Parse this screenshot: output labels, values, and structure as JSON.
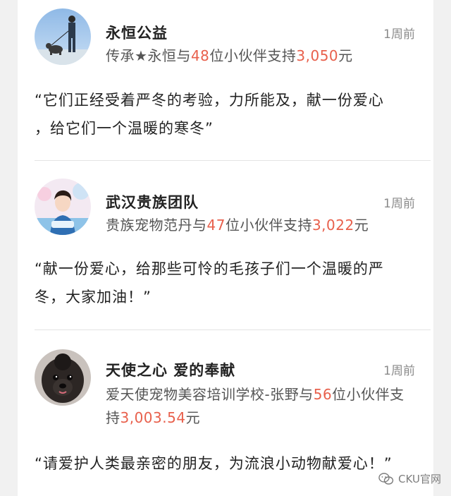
{
  "posts": [
    {
      "name": "永恒公益",
      "time": "1周前",
      "supporter": "传承★永恒",
      "mid1": "与",
      "count": "48",
      "mid2": "位小伙伴支持",
      "amount": "3,050",
      "unit": "元",
      "quote_line1": "“它们正经受着严冬的考验，力所能及，献一份爱心",
      "quote_line2": "，给它们一个温暖的寒冬”"
    },
    {
      "name": "武汉贵族团队",
      "time": "1周前",
      "supporter": "贵族宠物范丹",
      "mid1": "与",
      "count": "47",
      "mid2": "位小伙伴支持",
      "amount": "3,022",
      "unit": "元",
      "quote_line1": "“献一份爱心，给那些可怜的毛孩子们一个温暖的严",
      "quote_line2": "冬，大家加油！”"
    },
    {
      "name": "天使之心 爱的奉献",
      "time": "1周前",
      "supporter": "爱天使宠物美容培训学校-张野",
      "mid1": "与",
      "count": "56",
      "mid2": "位小伙伴支持",
      "amount": "3,003.54",
      "unit": "元",
      "quote_line1": "“请爱护人类最亲密的朋友，为流浪小动物献爱心！”",
      "quote_line2": ""
    }
  ],
  "watermark": {
    "text": "CKU官网",
    "icon": "wechat-icon"
  },
  "colors": {
    "highlight": "#e8604c",
    "divider": "#e4e4e4"
  }
}
